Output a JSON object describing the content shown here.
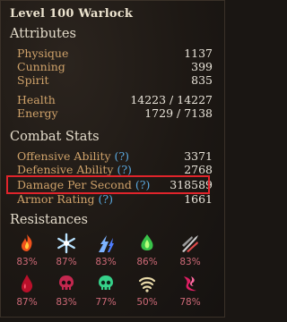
{
  "header": {
    "title": "Level 100 Warlock"
  },
  "attributes": {
    "section_title": "Attributes",
    "physique": {
      "label": "Physique",
      "value": "1137"
    },
    "cunning": {
      "label": "Cunning",
      "value": "399"
    },
    "spirit": {
      "label": "Spirit",
      "value": "835"
    },
    "health": {
      "label": "Health",
      "value": "14223 / 14227"
    },
    "energy": {
      "label": "Energy",
      "value": "1729 / 7138"
    }
  },
  "combat": {
    "section_title": "Combat Stats",
    "offensive": {
      "label": "Offensive Ability",
      "help": "(?)",
      "value": "3371"
    },
    "defensive": {
      "label": "Defensive Ability",
      "help": "(?)",
      "value": "2768"
    },
    "dps": {
      "label": "Damage Per Second",
      "help": "(?)",
      "value": "318589"
    },
    "armor": {
      "label": "Armor Rating",
      "help": "(?)",
      "value": "1661"
    }
  },
  "resistances": {
    "section_title": "Resistances",
    "items": [
      {
        "icon": "fire-icon",
        "value": "83%"
      },
      {
        "icon": "cold-icon",
        "value": "87%"
      },
      {
        "icon": "lightning-icon",
        "value": "83%"
      },
      {
        "icon": "poison-icon",
        "value": "86%"
      },
      {
        "icon": "pierce-icon",
        "value": "83%"
      },
      {
        "icon": "bleed-icon",
        "value": "87%"
      },
      {
        "icon": "vitality-icon",
        "value": "83%"
      },
      {
        "icon": "aether-icon",
        "value": "77%"
      },
      {
        "icon": "stun-icon",
        "value": "50%"
      },
      {
        "icon": "chaos-icon",
        "value": "78%"
      }
    ]
  },
  "colors": {
    "label": "#cfa26a",
    "value": "#e9e4da",
    "help": "#5aa7dd",
    "highlight": "#e0242b",
    "resistance_value": "#cf6a78"
  }
}
